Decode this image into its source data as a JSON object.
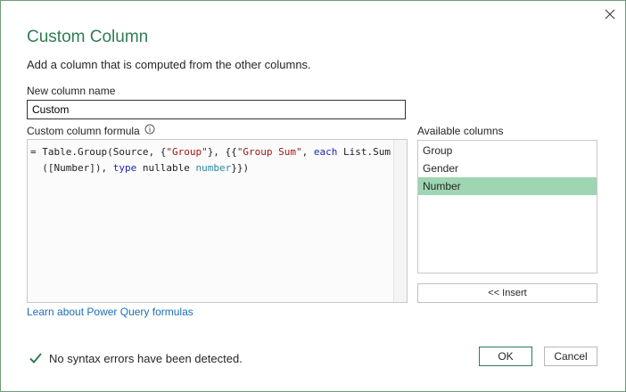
{
  "dialog": {
    "title": "Custom Column",
    "subtitle": "Add a column that is computed from the other columns.",
    "close_icon": "close-icon"
  },
  "name_field": {
    "label": "New column name",
    "value": "Custom"
  },
  "formula": {
    "label": "Custom column formula",
    "info_icon": "info-icon",
    "line1": {
      "prefix": "= Table.Group(Source, {",
      "str1": "\"Group\"",
      "mid1": "}, {{",
      "str2": "\"Group Sum\"",
      "mid2": ", ",
      "kw_each": "each",
      "suffix": " List.Sum"
    },
    "line2": {
      "prefix": "([Number]), ",
      "kw_type": "type",
      "mid": " nullable ",
      "type_number": "number",
      "suffix": "}})"
    }
  },
  "learn_link": "Learn about Power Query formulas",
  "available_columns": {
    "label": "Available columns",
    "items": [
      {
        "label": "Group",
        "selected": false
      },
      {
        "label": "Gender",
        "selected": false
      },
      {
        "label": "Number",
        "selected": true
      }
    ],
    "insert_label": "<< Insert"
  },
  "status": {
    "icon": "checkmark-icon",
    "text": "No syntax errors have been detected."
  },
  "buttons": {
    "ok": "OK",
    "cancel": "Cancel"
  },
  "colors": {
    "accent": "#2f7d53",
    "selection": "#9fd5b2",
    "link": "#1b6fb5",
    "string": "#a31515",
    "keyword": "#1f1fb5",
    "type": "#2b8a9e"
  }
}
